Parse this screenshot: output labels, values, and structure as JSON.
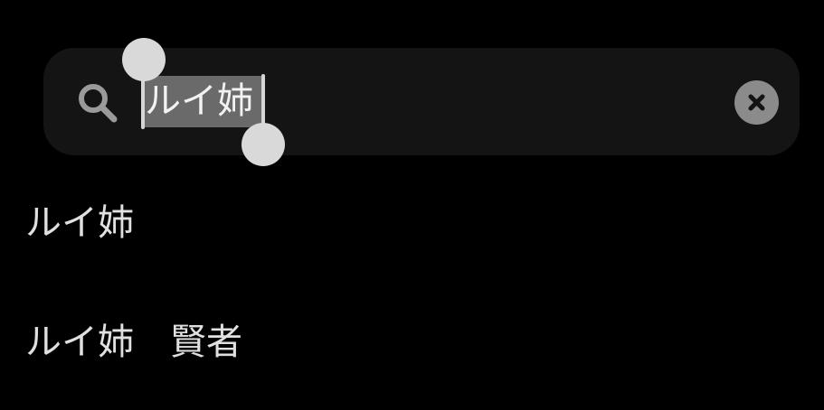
{
  "search": {
    "query": "ルイ姉",
    "icon": "magnifier-icon",
    "clear_icon": "x-icon"
  },
  "suggestions": [
    {
      "text": "ルイ姉"
    },
    {
      "text": "ルイ姉　賢者"
    }
  ],
  "colors": {
    "background": "#000000",
    "search_bar": "#141414",
    "selection": "#6a6a6a",
    "handle": "#d9d9d9",
    "clear_button": "#8b8b8b",
    "text": "#e0e0e0"
  }
}
